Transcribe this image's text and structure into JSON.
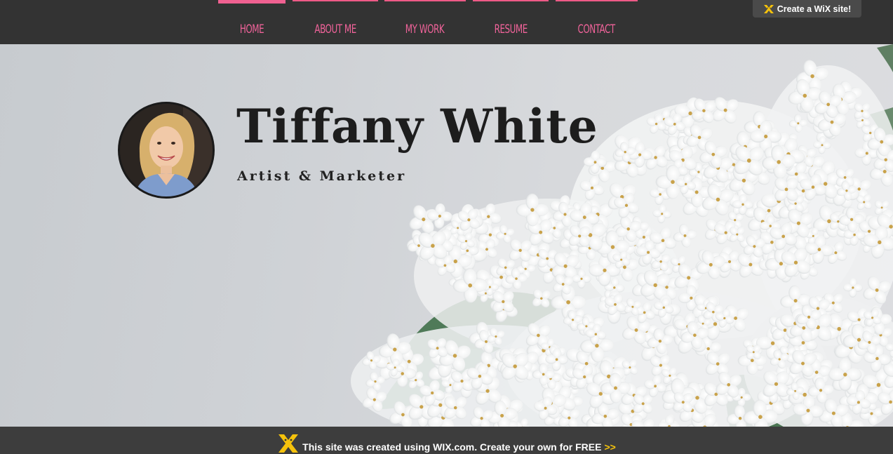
{
  "nav": {
    "items": [
      {
        "label": "HOME",
        "active": true
      },
      {
        "label": "ABOUT ME",
        "active": false
      },
      {
        "label": "MY WORK",
        "active": false
      },
      {
        "label": "RESUME",
        "active": false
      },
      {
        "label": "CONTACT",
        "active": false
      }
    ],
    "accent_color": "#f0639a",
    "background_color": "#333333"
  },
  "wix_badge": {
    "label": "Create a WiX site!",
    "icon": "wix-logo-icon"
  },
  "hero": {
    "title": "Tiffany White",
    "subtitle": "Artist & Marketer",
    "avatar_icon": "profile-photo",
    "background_image": "white-lilac-flowers"
  },
  "footer_banner": {
    "text": "This site was created using WIX.com. Create your own for FREE",
    "arrows": ">>",
    "icon": "wix-logo-icon"
  }
}
